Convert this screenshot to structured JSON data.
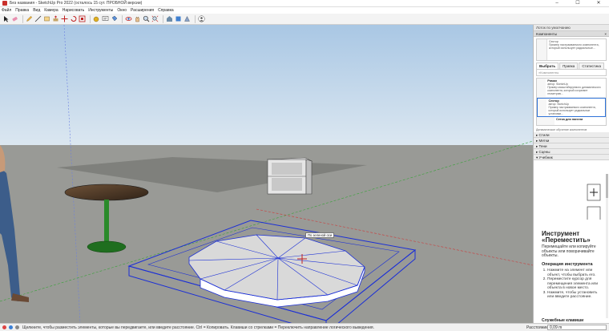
{
  "window": {
    "title": "Без названия - SketchUp Pro 2022 (осталось 15 сут. ПРОБНОЙ версии)",
    "minimize": "–",
    "maximize": "☐",
    "close": "✕"
  },
  "menu": [
    "Файл",
    "Правка",
    "Вид",
    "Камера",
    "Нарисовать",
    "Инструменты",
    "Окно",
    "Расширения",
    "Справка"
  ],
  "toolbar": {
    "icons": [
      "select-icon",
      "eraser-icon",
      "pencil-icon",
      "line-icon",
      "rectangle-icon",
      "push-pull-icon",
      "move-icon",
      "rotate-icon",
      "scale-icon",
      "tape-measure-icon",
      "text-icon",
      "paint-bucket-icon",
      "orbit-icon",
      "pan-icon",
      "zoom-icon",
      "zoom-extents-icon",
      "warehouse-icon",
      "extension-icon",
      "section-icon",
      "user-icon"
    ]
  },
  "tooltip": "По зеленой оси",
  "panel": {
    "title": "Лоток по умолчанию",
    "components_header": "Компоненты",
    "preview_name": "Сектор",
    "preview_desc": "Пример настраиваемого компонента, который использует радиальные...",
    "tabs": [
      "Выбрать",
      "Правка",
      "Статистика"
    ],
    "search_placeholder": "Компоненты",
    "items": [
      {
        "name": "Рамки",
        "author": "автор: SketchUp",
        "desc": "Пример масштабируемого динамического компонента, который сохраняет геометрию..."
      },
      {
        "name": "Сектор",
        "author": "автор: SketchUp",
        "desc": "Пример настраиваемого компонента, который использует радиальные установки..."
      },
      {
        "name": "Сетка для панели",
        "author": "",
        "desc": ""
      }
    ],
    "dynamic_line": "Динамическое обучение компонентов",
    "collapsed": [
      "Стили",
      "Метки",
      "Тени",
      "Сцены"
    ],
    "tutorial_header": "Учебник",
    "instructor": {
      "title": "Инструмент «Переместить»",
      "desc": "Перемещайте или копируйте объекты или поворачивайте объекты.",
      "op_title": "Операция инструмента",
      "steps": [
        "Нажмите на элемент или объект, чтобы выбрать его.",
        "Переместите курсор для перемещения элемента или объекта в новое место.",
        "Нажмите, чтобы установить или введите расстояние."
      ],
      "cut_text": "Служебные клавиши"
    }
  },
  "status": {
    "message": "Щелкните, чтобы разместить элементы, которые вы передвигаете, или введите расстояние. Ctrl = Копировать. Клавиши со стрелками = Переключить направление логического выведения.",
    "measure_label": "Расстояние",
    "measure_value": "0,09 m"
  },
  "colors": {
    "sky": "#c9daea",
    "ground": "#999a96",
    "selection": "#1b2fd6",
    "red_axis": "#cc3a3a",
    "green_axis": "#3aa33a",
    "blue_axis": "#3b5bd6"
  }
}
